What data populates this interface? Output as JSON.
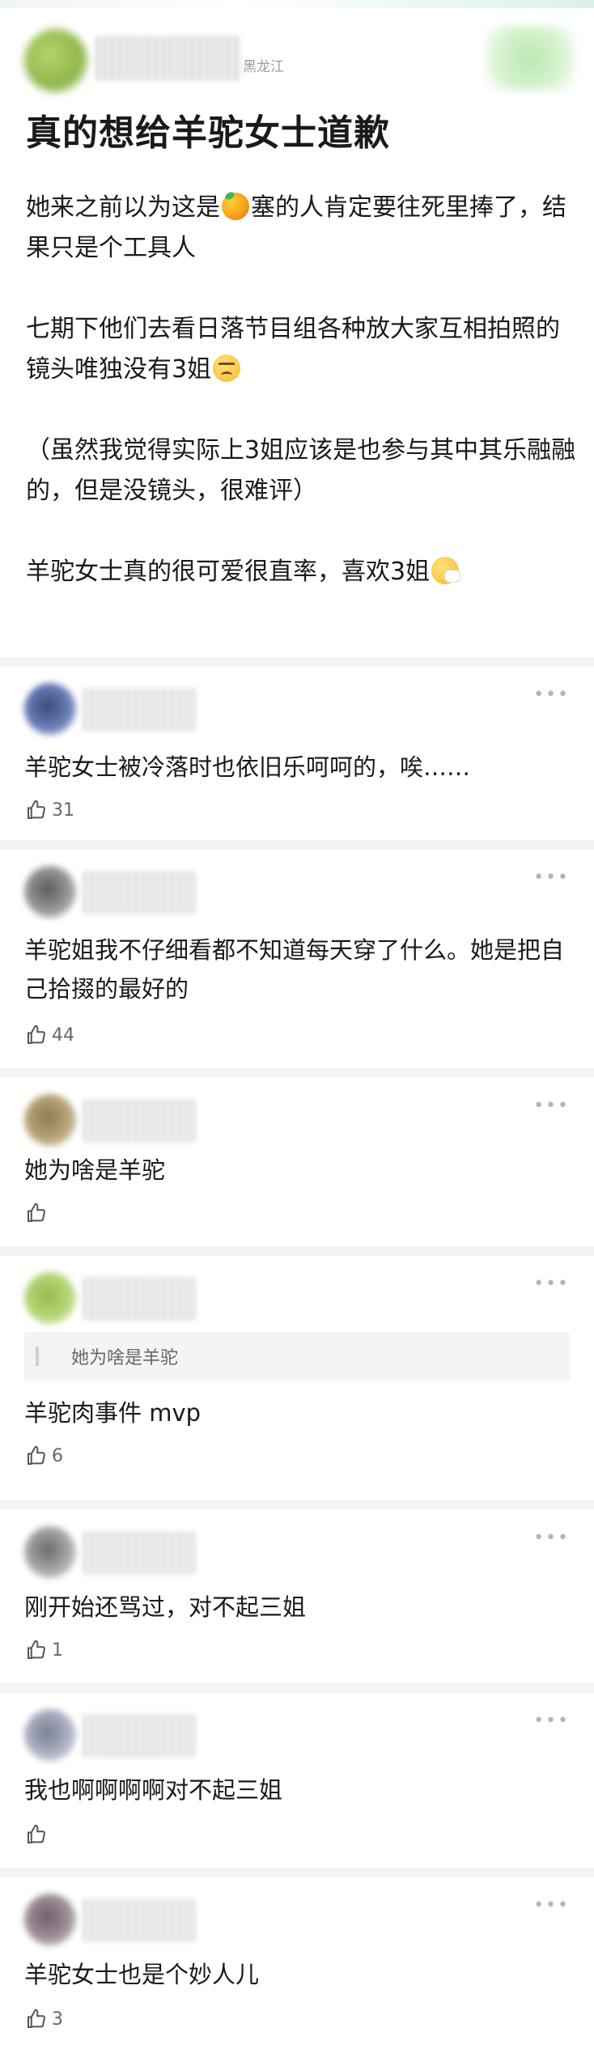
{
  "header": {
    "location": "黑龙江",
    "title": "真的想给羊驼女士道歉"
  },
  "post": {
    "p1_before_emoji": "她来之前以为这是",
    "p1_emoji": "mango-emoji",
    "p1_after_emoji": "塞的人肯定要往死里捧了，结果只是个工具人",
    "p2_text": "七期下他们去看日落节目组各种放大家互相拍照的镜头唯独没有3姐",
    "p2_emoji": "angry-face-emoji",
    "p3_text": "（虽然我觉得实际上3姐应该是也参与其中其乐融融的，但是没镜头，很难评）",
    "p4_text": "羊驼女士真的很可爱很直率，喜欢3姐",
    "p4_emoji": "sneezing-face-emoji"
  },
  "more_label": "•••",
  "comments": [
    {
      "text": "羊驼女士被冷落时也依旧乐呵呵的，唉……",
      "likes": "31",
      "quote": ""
    },
    {
      "text": "羊驼姐我不仔细看都不知道每天穿了什么。她是把自己拾掇的最好的",
      "likes": "44",
      "quote": ""
    },
    {
      "text": "她为啥是羊驼",
      "likes": "",
      "quote": ""
    },
    {
      "text": "羊驼肉事件 mvp",
      "likes": "6",
      "quote": "她为啥是羊驼"
    },
    {
      "text": "刚开始还骂过，对不起三姐",
      "likes": "1",
      "quote": ""
    },
    {
      "text": "我也啊啊啊啊对不起三姐",
      "likes": "",
      "quote": ""
    },
    {
      "text": "羊驼女士也是个妙人儿",
      "likes": "3",
      "quote": ""
    }
  ],
  "colors": {
    "text": "#1a1a1a",
    "muted": "#666666",
    "divider": "#f4f4f4"
  }
}
